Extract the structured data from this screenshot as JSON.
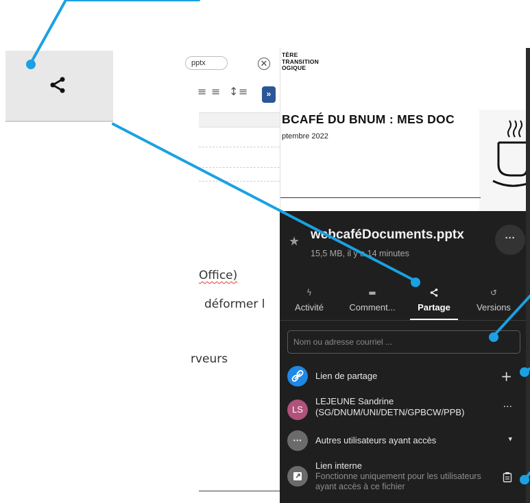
{
  "editor": {
    "filename_fragment": "pptx",
    "close_glyph": "✕",
    "expand_glyph": "»",
    "text_line_1": "Office)",
    "text_line_2": "déformer l",
    "text_line_3": "rveurs"
  },
  "slide": {
    "ministry_line_1": "TÈRE",
    "ministry_line_2": "TRANSITION",
    "ministry_line_3": "OGIQUE",
    "title": "BCAFÉ DU BNUM : MES DOC",
    "date": "ptembre 2022"
  },
  "sidebar": {
    "file_name": "webcaféDocuments.pptx",
    "file_meta": "15,5 MB, il y a 14 minutes",
    "more_label": "···",
    "tabs": [
      {
        "label": "Activité",
        "icon": "lightning-icon"
      },
      {
        "label": "Comment...",
        "icon": "comment-icon"
      },
      {
        "label": "Partage",
        "icon": "share-icon",
        "active": true
      },
      {
        "label": "Versions",
        "icon": "history-icon"
      }
    ],
    "search_placeholder": "Nom ou adresse courriel ...",
    "share_link": {
      "label": "Lien de partage",
      "action": "+"
    },
    "user": {
      "initials": "LS",
      "name": "LEJEUNE Sandrine",
      "group": "(SG/DNUM/UNI/DETN/GPBCW/PPB)",
      "action": "···"
    },
    "others": {
      "label": "Autres utilisateurs ayant accès",
      "action": "▾"
    },
    "internal_link": {
      "label": "Lien interne",
      "description": "Fonctionne uniquement pour les utilisateurs ayant accès à ce fichier"
    }
  },
  "colors": {
    "callout_blue": "#1ba1e2",
    "sidebar_bg": "#1f1f1f",
    "link_avatar": "#1e88e5",
    "user_avatar": "#b0527c",
    "grey_avatar": "#6b6b6b"
  }
}
